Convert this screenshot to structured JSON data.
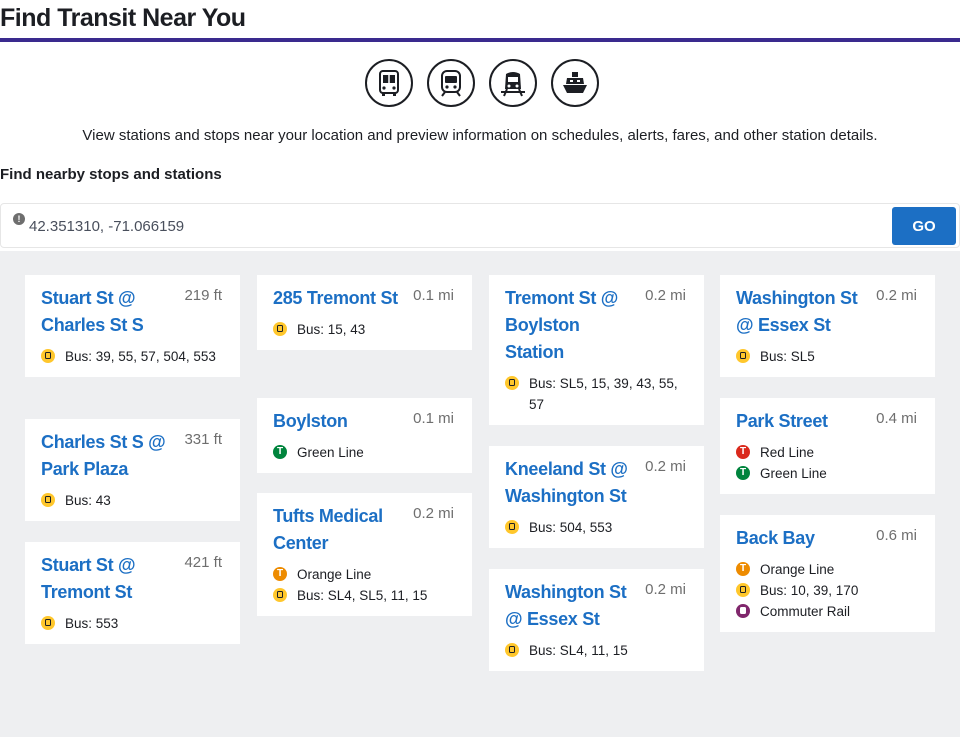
{
  "page": {
    "title": "Find Transit Near You",
    "intro": "View stations and stops near your location and preview information on schedules, alerts, fares, and other station details.",
    "section_label": "Find nearby stops and stations"
  },
  "modes": [
    {
      "name": "bus-mode-icon"
    },
    {
      "name": "subway-mode-icon"
    },
    {
      "name": "commuter-rail-mode-icon"
    },
    {
      "name": "ferry-mode-icon"
    }
  ],
  "search": {
    "value": "42.351310, -71.066159",
    "button_label": "GO",
    "alert_icon": "exclamation-icon"
  },
  "colors": {
    "link": "#1c6fc4",
    "bus": "#ffc72c",
    "red_line": "#da291c",
    "green_line": "#00843d",
    "orange_line": "#ed8b00",
    "commuter_rail": "#80276c",
    "header_rule": "#3a2a8e",
    "background": "#eeeff1"
  },
  "columns": [
    [
      {
        "name": "Stuart St @ Charles St S",
        "distance": "219 ft",
        "routes": [
          {
            "type": "bus",
            "text": "Bus: 39, 55, 57, 504, 553"
          }
        ]
      },
      {
        "name": "Charles St S @ Park Plaza",
        "distance": "331 ft",
        "routes": [
          {
            "type": "bus",
            "text": "Bus: 43"
          }
        ]
      },
      {
        "name": "Stuart St @ Tremont St",
        "distance": "421 ft",
        "routes": [
          {
            "type": "bus",
            "text": "Bus: 553"
          }
        ]
      }
    ],
    [
      {
        "name": "285 Tremont St",
        "distance": "0.1 mi",
        "routes": [
          {
            "type": "bus",
            "text": "Bus: 15, 43"
          }
        ]
      },
      {
        "name": "Boylston",
        "distance": "0.1 mi",
        "routes": [
          {
            "type": "green",
            "text": "Green Line"
          }
        ]
      },
      {
        "name": "Tufts Medical Center",
        "distance": "0.2 mi",
        "routes": [
          {
            "type": "orange",
            "text": "Orange Line"
          },
          {
            "type": "bus",
            "text": "Bus: SL4, SL5, 11, 15"
          }
        ]
      }
    ],
    [
      {
        "name": "Tremont St @ Boylston Station",
        "distance": "0.2 mi",
        "routes": [
          {
            "type": "bus",
            "text": "Bus: SL5, 15, 39, 43, 55, 57"
          }
        ]
      },
      {
        "name": "Kneeland St @ Washington St",
        "distance": "0.2 mi",
        "routes": [
          {
            "type": "bus",
            "text": "Bus: 504, 553"
          }
        ]
      },
      {
        "name": "Washington St @ Essex St",
        "distance": "0.2 mi",
        "routes": [
          {
            "type": "bus",
            "text": "Bus: SL4, 11, 15"
          }
        ]
      }
    ],
    [
      {
        "name": "Washington St @ Essex St",
        "distance": "0.2 mi",
        "routes": [
          {
            "type": "bus",
            "text": "Bus: SL5"
          }
        ]
      },
      {
        "name": "Park Street",
        "distance": "0.4 mi",
        "routes": [
          {
            "type": "red",
            "text": "Red Line"
          },
          {
            "type": "green",
            "text": "Green Line"
          }
        ]
      },
      {
        "name": "Back Bay",
        "distance": "0.6 mi",
        "routes": [
          {
            "type": "orange",
            "text": "Orange Line"
          },
          {
            "type": "bus",
            "text": "Bus: 10, 39, 170"
          },
          {
            "type": "rail",
            "text": "Commuter Rail"
          }
        ]
      }
    ]
  ]
}
